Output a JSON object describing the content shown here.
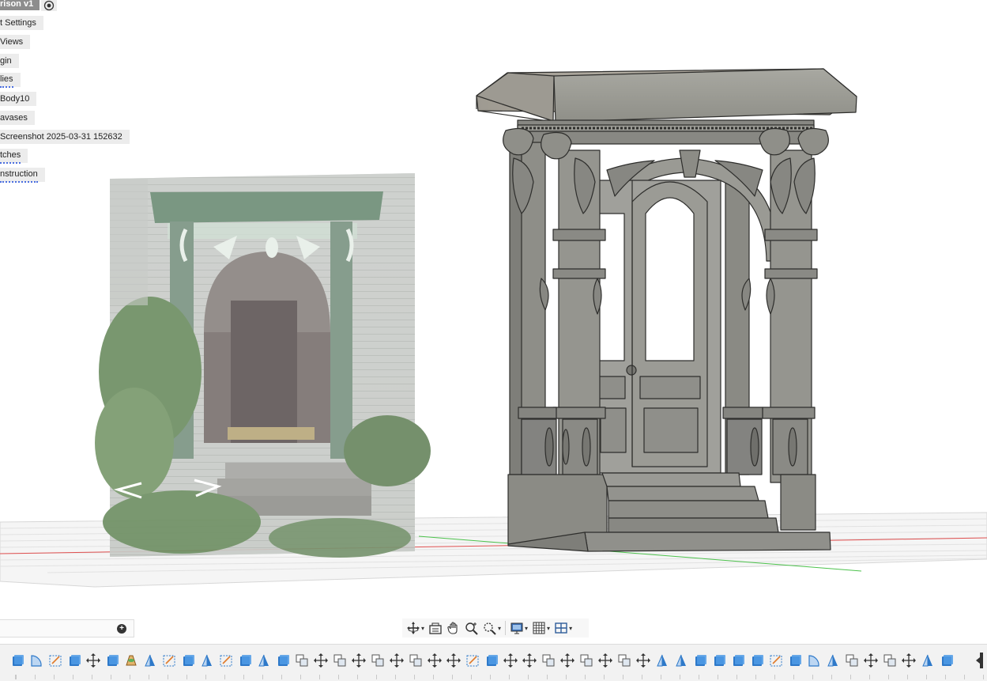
{
  "browser": {
    "root_title": "rison v1",
    "items": [
      {
        "label": "t Settings"
      },
      {
        "label": "Views"
      },
      {
        "label": "gin"
      },
      {
        "label": "lies"
      },
      {
        "label": "Body10"
      },
      {
        "label": "avases"
      },
      {
        "label": "Screenshot 2025-03-31 152632"
      },
      {
        "label": "tches"
      },
      {
        "label": "nstruction"
      }
    ]
  },
  "canvas_image": {
    "prev_label": "<",
    "next_label": ">"
  },
  "comments": {
    "add_icon": "plus-circle-icon"
  },
  "nav_toolbar": {
    "tools": [
      {
        "icon": "orbit-icon",
        "has_menu": true
      },
      {
        "icon": "look-at-icon",
        "has_menu": false
      },
      {
        "icon": "pan-hand-icon",
        "has_menu": false
      },
      {
        "icon": "zoom-icon",
        "has_menu": false
      },
      {
        "icon": "fit-zoom-icon",
        "has_menu": true
      },
      {
        "icon": "display-settings-icon",
        "has_menu": true
      },
      {
        "icon": "grid-icon",
        "has_menu": true
      },
      {
        "icon": "viewports-icon",
        "has_menu": true
      }
    ]
  },
  "timeline": {
    "items": [
      "extrude",
      "revolve",
      "sketch",
      "extrude",
      "move",
      "extrude",
      "loft",
      "mirror",
      "sketch",
      "extrude",
      "mirror",
      "sketch",
      "extrude",
      "mirror",
      "extrude",
      "combine",
      "move",
      "combine",
      "move",
      "combine",
      "move",
      "combine",
      "move",
      "move",
      "sketch",
      "extrude",
      "move",
      "move",
      "combine",
      "move",
      "combine",
      "move",
      "combine",
      "move",
      "mirror",
      "mirror",
      "extrude",
      "extrude",
      "extrude",
      "extrude",
      "sketch",
      "extrude",
      "revolve",
      "mirror",
      "combine",
      "move",
      "combine",
      "move",
      "mirror",
      "extrude"
    ]
  },
  "colors": {
    "toolbar_bg": "#f2f2f2",
    "root_header_bg": "#8d8d8d",
    "tree_item_bg": "#ececec",
    "error_underline": "#4a6ee0",
    "model_gray": "#8a8a84",
    "x_axis_red": "#e05050",
    "y_axis_green": "#4cc24c"
  }
}
